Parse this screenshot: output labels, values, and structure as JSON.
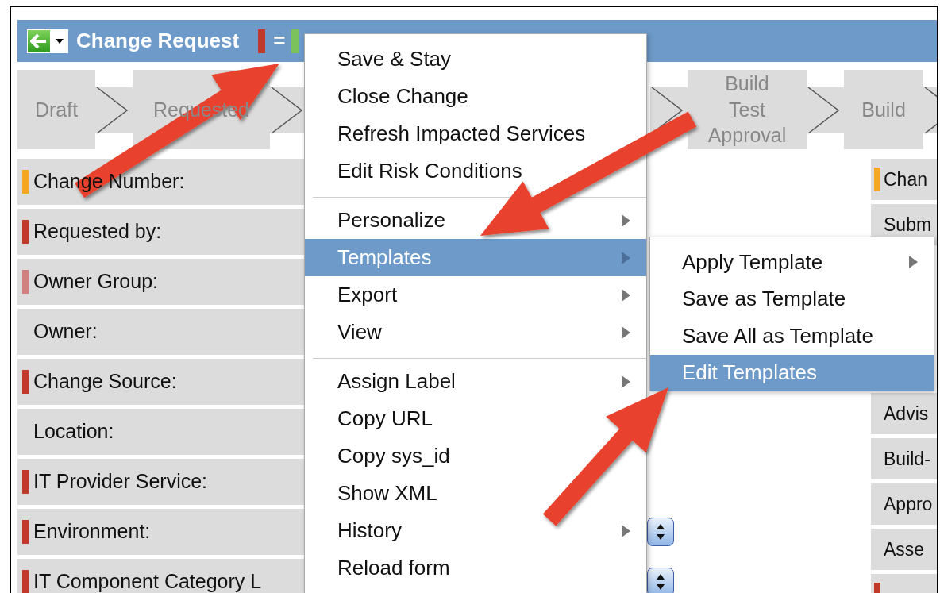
{
  "header": {
    "title": "Change Request",
    "legend_marks": [
      {
        "color": "#c0392b"
      },
      {
        "color": "#7cc25c"
      }
    ],
    "legend_text": "="
  },
  "stages": [
    {
      "label": "Draft"
    },
    {
      "label": "Requested"
    },
    {
      "label": "Build\nTest\nApproval"
    },
    {
      "label": "Build"
    }
  ],
  "fields": [
    {
      "label": "Change Number:",
      "color": "#f5a623",
      "has_spinner": false
    },
    {
      "label": "Requested by:",
      "color": "#c0392b",
      "has_spinner": false
    },
    {
      "label": "Owner Group:",
      "color": "#d08080",
      "has_spinner": false
    },
    {
      "label": "Owner:",
      "has_spinner": false
    },
    {
      "label": "Change Source:",
      "color": "#c0392b",
      "has_spinner": false
    },
    {
      "label": "Location:",
      "has_spinner": false
    },
    {
      "label": "IT Provider Service:",
      "color": "#c0392b",
      "has_spinner": false
    },
    {
      "label": "Environment:",
      "color": "#c0392b",
      "has_spinner": true
    },
    {
      "label": "IT Component Category L",
      "color": "#c0392b",
      "has_spinner": true
    }
  ],
  "right_fields": [
    {
      "label": "Chan",
      "color": "#f5a623"
    },
    {
      "label": "Subm"
    },
    {
      "label": "Advis"
    },
    {
      "label": "Build-"
    },
    {
      "label": "Appro"
    },
    {
      "label": "Asse"
    },
    {
      "color": "#c0392b"
    }
  ],
  "menu": {
    "sections": [
      [
        {
          "label": "Save & Stay",
          "submenu": false,
          "selected": false
        },
        {
          "label": "Close Change",
          "submenu": false,
          "selected": false
        },
        {
          "label": "Refresh Impacted Services",
          "submenu": false,
          "selected": false
        },
        {
          "label": "Edit Risk Conditions",
          "submenu": false,
          "selected": false
        }
      ],
      [
        {
          "label": "Personalize",
          "submenu": true,
          "selected": false
        },
        {
          "label": "Templates",
          "submenu": true,
          "selected": true
        },
        {
          "label": "Export",
          "submenu": true,
          "selected": false
        },
        {
          "label": "View",
          "submenu": true,
          "selected": false
        }
      ],
      [
        {
          "label": "Assign Label",
          "submenu": true,
          "selected": false
        },
        {
          "label": "Copy URL",
          "submenu": false,
          "selected": false
        },
        {
          "label": "Copy sys_id",
          "submenu": false,
          "selected": false
        },
        {
          "label": "Show XML",
          "submenu": false,
          "selected": false
        },
        {
          "label": "History",
          "submenu": true,
          "selected": false
        },
        {
          "label": "Reload form",
          "submenu": false,
          "selected": false
        }
      ]
    ]
  },
  "submenu": {
    "items": [
      {
        "label": "Apply Template",
        "submenu": true,
        "selected": false
      },
      {
        "label": "Save as Template",
        "submenu": false,
        "selected": false
      },
      {
        "label": "Save All as Template",
        "submenu": false,
        "selected": false
      },
      {
        "label": "Edit Templates",
        "submenu": false,
        "selected": true
      }
    ]
  }
}
